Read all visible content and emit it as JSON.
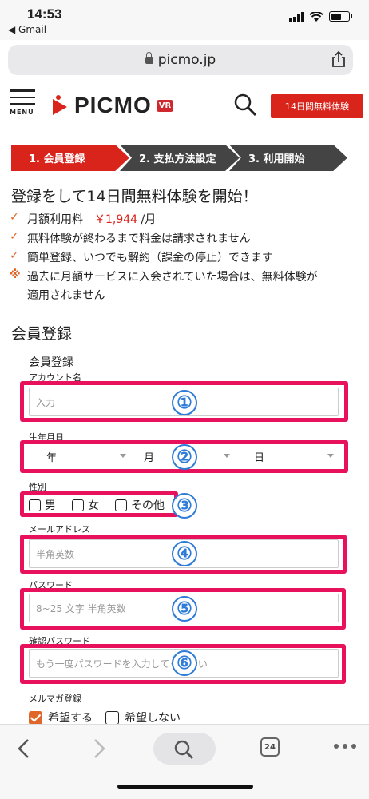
{
  "status": {
    "time": "14:53",
    "back_app": "◀ Gmail"
  },
  "browser": {
    "url": "picmo.jp",
    "tabs_count": "24"
  },
  "header": {
    "menu_label": "MENU",
    "logo_text": "PICMO",
    "logo_badge": "VR",
    "trial_button": "14日間無料体験"
  },
  "steps": [
    "1. 会員登録",
    "2. 支払方法設定",
    "3. 利用開始"
  ],
  "intro": {
    "title": "登録をして14日間無料体験を開始！",
    "features": [
      {
        "mark": "✓",
        "text_a": "月額利用料　",
        "price": "￥1,944",
        "text_b": " /月"
      },
      {
        "mark": "✓",
        "text": "無料体験が終わるまで料金は請求されません"
      },
      {
        "mark": "✓",
        "text": "簡単登録、いつでも解約（課金の停止）できます"
      },
      {
        "mark": "※",
        "text": "過去に月額サービスに入会されていた場合は、無料体験が"
      },
      {
        "text": "適用されません"
      }
    ]
  },
  "form": {
    "section_title": "会員登録",
    "form_title": "会員登録",
    "account_label": "アカウント名",
    "account_placeholder": "入力",
    "birth_label": "生年月日",
    "year": "年",
    "month": "月",
    "day": "日",
    "gender_label": "性別",
    "gender_options": [
      "男",
      "女",
      "その他"
    ],
    "email_label": "メールアドレス",
    "email_placeholder": "半角英数",
    "password_label": "パスワード",
    "password_placeholder": "8~25 文字 半角英数",
    "confirm_label": "確認パスワード",
    "confirm_placeholder": "もう一度パスワードを入力してください",
    "newsletter_label": "メルマガ登録",
    "newsletter_yes": "希望する",
    "newsletter_no": "希望しない"
  },
  "annotations": [
    "①",
    "②",
    "③",
    "④",
    "⑤",
    "⑥"
  ],
  "colors": {
    "brand": "#d9241c",
    "highlight": "#e8125c",
    "check": "#e0662a",
    "badge": "#2e7bd8"
  }
}
